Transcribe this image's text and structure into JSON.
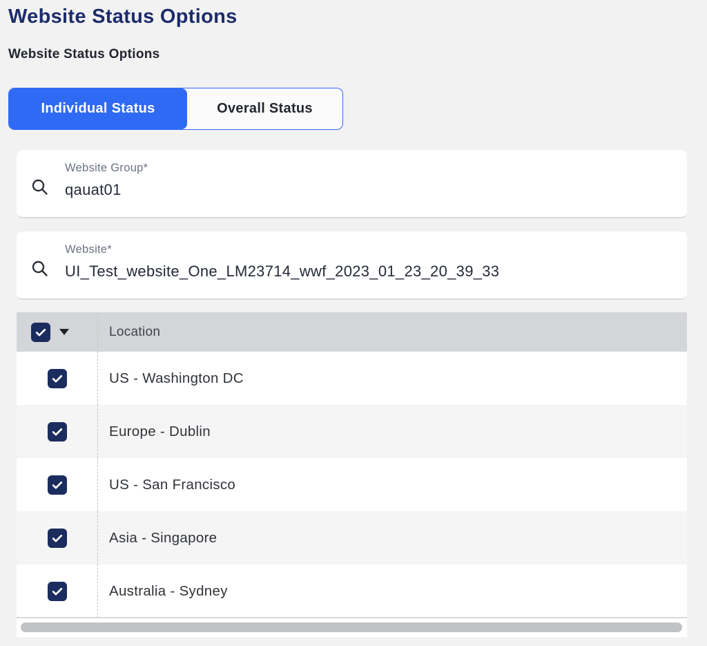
{
  "page": {
    "title": "Website Status Options",
    "subtitle": "Website Status Options"
  },
  "tabs": [
    {
      "label": "Individual Status",
      "active": true
    },
    {
      "label": "Overall Status",
      "active": false
    }
  ],
  "fields": [
    {
      "label": "Website Group*",
      "value": "qauat01"
    },
    {
      "label": "Website*",
      "value": "UI_Test_website_One_LM23714_wwf_2023_01_23_20_39_33"
    }
  ],
  "table": {
    "header": {
      "location_label": "Location",
      "select_all": true
    },
    "rows": [
      {
        "location": "US - Washington DC",
        "checked": true
      },
      {
        "location": "Europe - Dublin",
        "checked": true
      },
      {
        "location": "US - San Francisco",
        "checked": true
      },
      {
        "location": "Asia - Singapore",
        "checked": true
      },
      {
        "location": "Australia - Sydney",
        "checked": true
      }
    ]
  },
  "icons": {
    "search": "magnifier",
    "select_all_caret": "chevron-down-triangle",
    "checkbox_check": "checkmark"
  },
  "colors": {
    "accent_blue": "#2f6af4",
    "title_navy": "#1c2c6a",
    "checkbox_navy": "#1b2c5e",
    "page_background": "#f2f2f3",
    "table_header_gray": "#d4d5d8",
    "alt_row_gray": "#f5f5f6",
    "scroll_thumb_gray": "#c1c2c4"
  }
}
